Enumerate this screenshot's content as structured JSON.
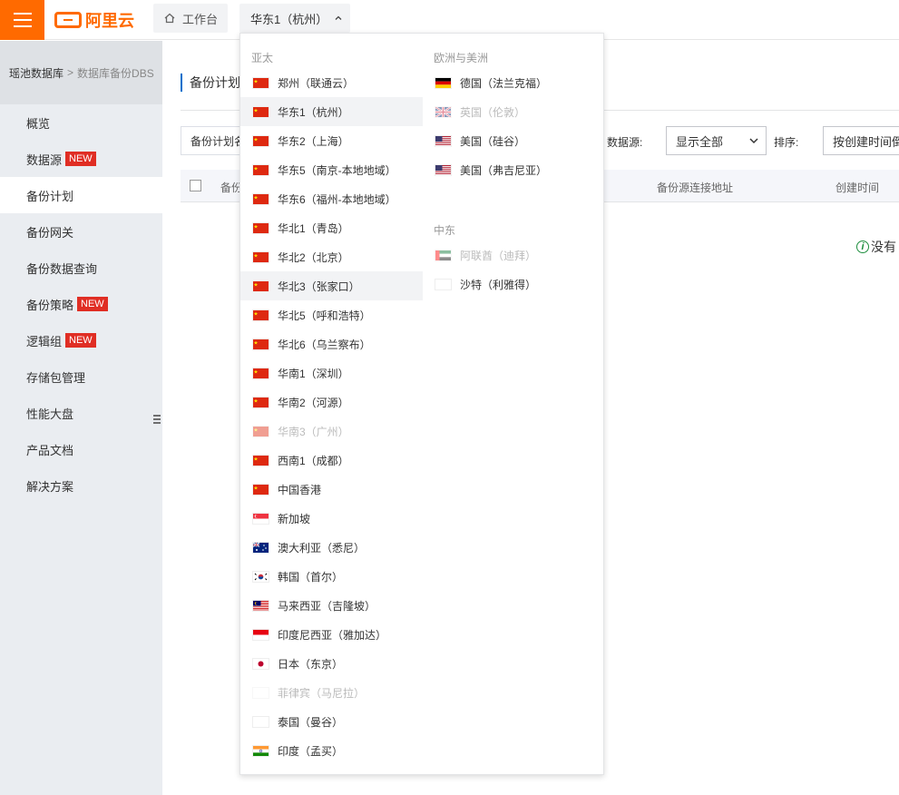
{
  "topbar": {
    "brand": "阿里云",
    "workbench_label": "工作台",
    "region_label": "华东1（杭州）"
  },
  "sidebar": {
    "breadcrumb": {
      "root": "瑶池数据库",
      "separator": ">",
      "current": "数据库备份DBS"
    },
    "items": [
      {
        "label": "概览",
        "badge": ""
      },
      {
        "label": "数据源",
        "badge": "NEW"
      },
      {
        "label": "备份计划",
        "badge": ""
      },
      {
        "label": "备份网关",
        "badge": ""
      },
      {
        "label": "备份数据查询",
        "badge": ""
      },
      {
        "label": "备份策略",
        "badge": "NEW"
      },
      {
        "label": "逻辑组",
        "badge": "NEW"
      },
      {
        "label": "存储包管理",
        "badge": ""
      },
      {
        "label": "性能大盘",
        "badge": ""
      },
      {
        "label": "产品文档",
        "badge": ""
      },
      {
        "label": "解决方案",
        "badge": ""
      }
    ]
  },
  "main": {
    "title": "备份计划",
    "search_text": "备份计划名",
    "ds_label": "数据源:",
    "ds_value": "显示全部",
    "sort_label": "排序:",
    "sort_value": "按创建时间倒序",
    "columns": {
      "c1": "备份",
      "c2": "备份源连接地址",
      "c3": "创建时间"
    },
    "empty_text": "没有"
  },
  "dropdown": {
    "asia_title": "亚太",
    "asia": [
      {
        "label": "郑州（联通云）",
        "flag": "cn",
        "state": ""
      },
      {
        "label": "华东1（杭州）",
        "flag": "cn",
        "state": "hover"
      },
      {
        "label": "华东2（上海）",
        "flag": "cn",
        "state": ""
      },
      {
        "label": "华东5（南京-本地地域）",
        "flag": "cn",
        "state": ""
      },
      {
        "label": "华东6（福州-本地地域）",
        "flag": "cn",
        "state": ""
      },
      {
        "label": "华北1（青岛）",
        "flag": "cn",
        "state": ""
      },
      {
        "label": "华北2（北京）",
        "flag": "cn",
        "state": ""
      },
      {
        "label": "华北3（张家口）",
        "flag": "cn",
        "state": "hover"
      },
      {
        "label": "华北5（呼和浩特）",
        "flag": "cn",
        "state": ""
      },
      {
        "label": "华北6（乌兰察布）",
        "flag": "cn",
        "state": ""
      },
      {
        "label": "华南1（深圳）",
        "flag": "cn",
        "state": ""
      },
      {
        "label": "华南2（河源）",
        "flag": "cn",
        "state": ""
      },
      {
        "label": "华南3（广州）",
        "flag": "cn",
        "state": "disabled"
      },
      {
        "label": "西南1（成都）",
        "flag": "cn",
        "state": ""
      },
      {
        "label": "中国香港",
        "flag": "cn",
        "state": ""
      },
      {
        "label": "新加坡",
        "flag": "sg",
        "state": ""
      },
      {
        "label": "澳大利亚（悉尼）",
        "flag": "au",
        "state": ""
      },
      {
        "label": "韩国（首尔）",
        "flag": "kr",
        "state": ""
      },
      {
        "label": "马来西亚（吉隆坡）",
        "flag": "my",
        "state": ""
      },
      {
        "label": "印度尼西亚（雅加达）",
        "flag": "id",
        "state": ""
      },
      {
        "label": "日本（东京）",
        "flag": "jp",
        "state": ""
      },
      {
        "label": "菲律宾（马尼拉）",
        "flag": "blank",
        "state": "disabled"
      },
      {
        "label": "泰国（曼谷）",
        "flag": "blank",
        "state": ""
      },
      {
        "label": "印度（孟买）",
        "flag": "in",
        "state": ""
      }
    ],
    "europe_title": "欧洲与美洲",
    "europe": [
      {
        "label": "德国（法兰克福）",
        "flag": "de",
        "state": ""
      },
      {
        "label": "英国（伦敦）",
        "flag": "gb",
        "state": "disabled"
      },
      {
        "label": "美国（硅谷）",
        "flag": "us",
        "state": ""
      },
      {
        "label": "美国（弗吉尼亚）",
        "flag": "us",
        "state": ""
      }
    ],
    "mideast_title": "中东",
    "mideast": [
      {
        "label": "阿联酋（迪拜）",
        "flag": "ae",
        "state": "disabled"
      },
      {
        "label": "沙特（利雅得）",
        "flag": "blank",
        "state": ""
      }
    ]
  },
  "colors": {
    "accent": "#ff6a00",
    "new_badge": "#e02e24",
    "link_blue": "#0070cc"
  }
}
